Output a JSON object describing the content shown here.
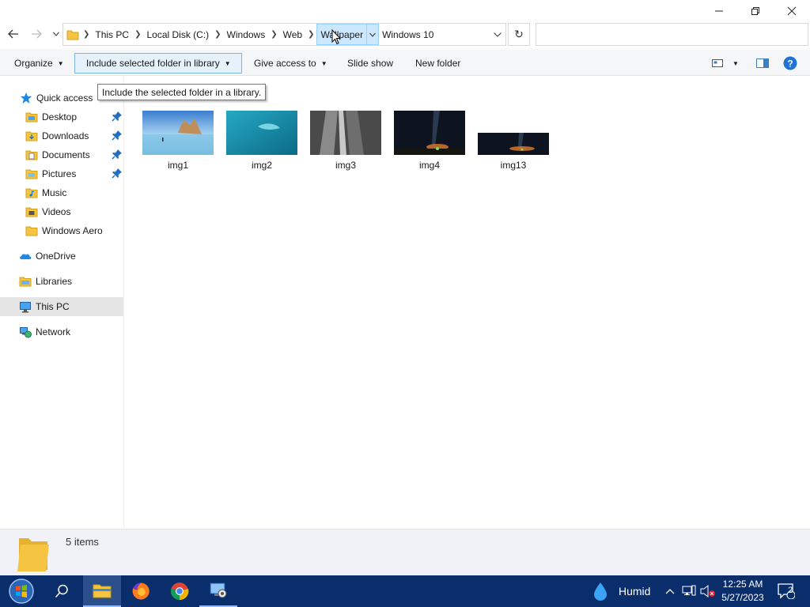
{
  "address": {
    "crumbs": [
      "This PC",
      "Local Disk (C:)",
      "Windows",
      "Web",
      "Wallpaper",
      "Windows 10"
    ],
    "search_placeholder": ""
  },
  "toolbar": {
    "organize": "Organize",
    "include_library": "Include selected folder in library",
    "give_access": "Give access to",
    "slide_show": "Slide show",
    "new_folder": "New folder"
  },
  "tooltip": "Include the selected folder in a library.",
  "sidebar": {
    "quick_access": "Quick access",
    "items": [
      {
        "label": "Desktop",
        "pinned": true
      },
      {
        "label": "Downloads",
        "pinned": true
      },
      {
        "label": "Documents",
        "pinned": true
      },
      {
        "label": "Pictures",
        "pinned": true
      },
      {
        "label": "Music",
        "pinned": false
      },
      {
        "label": "Videos",
        "pinned": false
      },
      {
        "label": "Windows Aero",
        "pinned": false
      }
    ],
    "onedrive": "OneDrive",
    "libraries": "Libraries",
    "this_pc": "This PC",
    "network": "Network"
  },
  "files": [
    {
      "name": "img1"
    },
    {
      "name": "img2"
    },
    {
      "name": "img3"
    },
    {
      "name": "img4"
    },
    {
      "name": "img13"
    }
  ],
  "status": {
    "count": "5 items"
  },
  "taskbar": {
    "weather": "Humid",
    "time": "12:25 AM",
    "date": "5/27/2023",
    "notifications": "2"
  },
  "colors": {
    "accent": "#0078d7",
    "taskbar": "#0a2d6b",
    "folder": "#f5c542"
  }
}
